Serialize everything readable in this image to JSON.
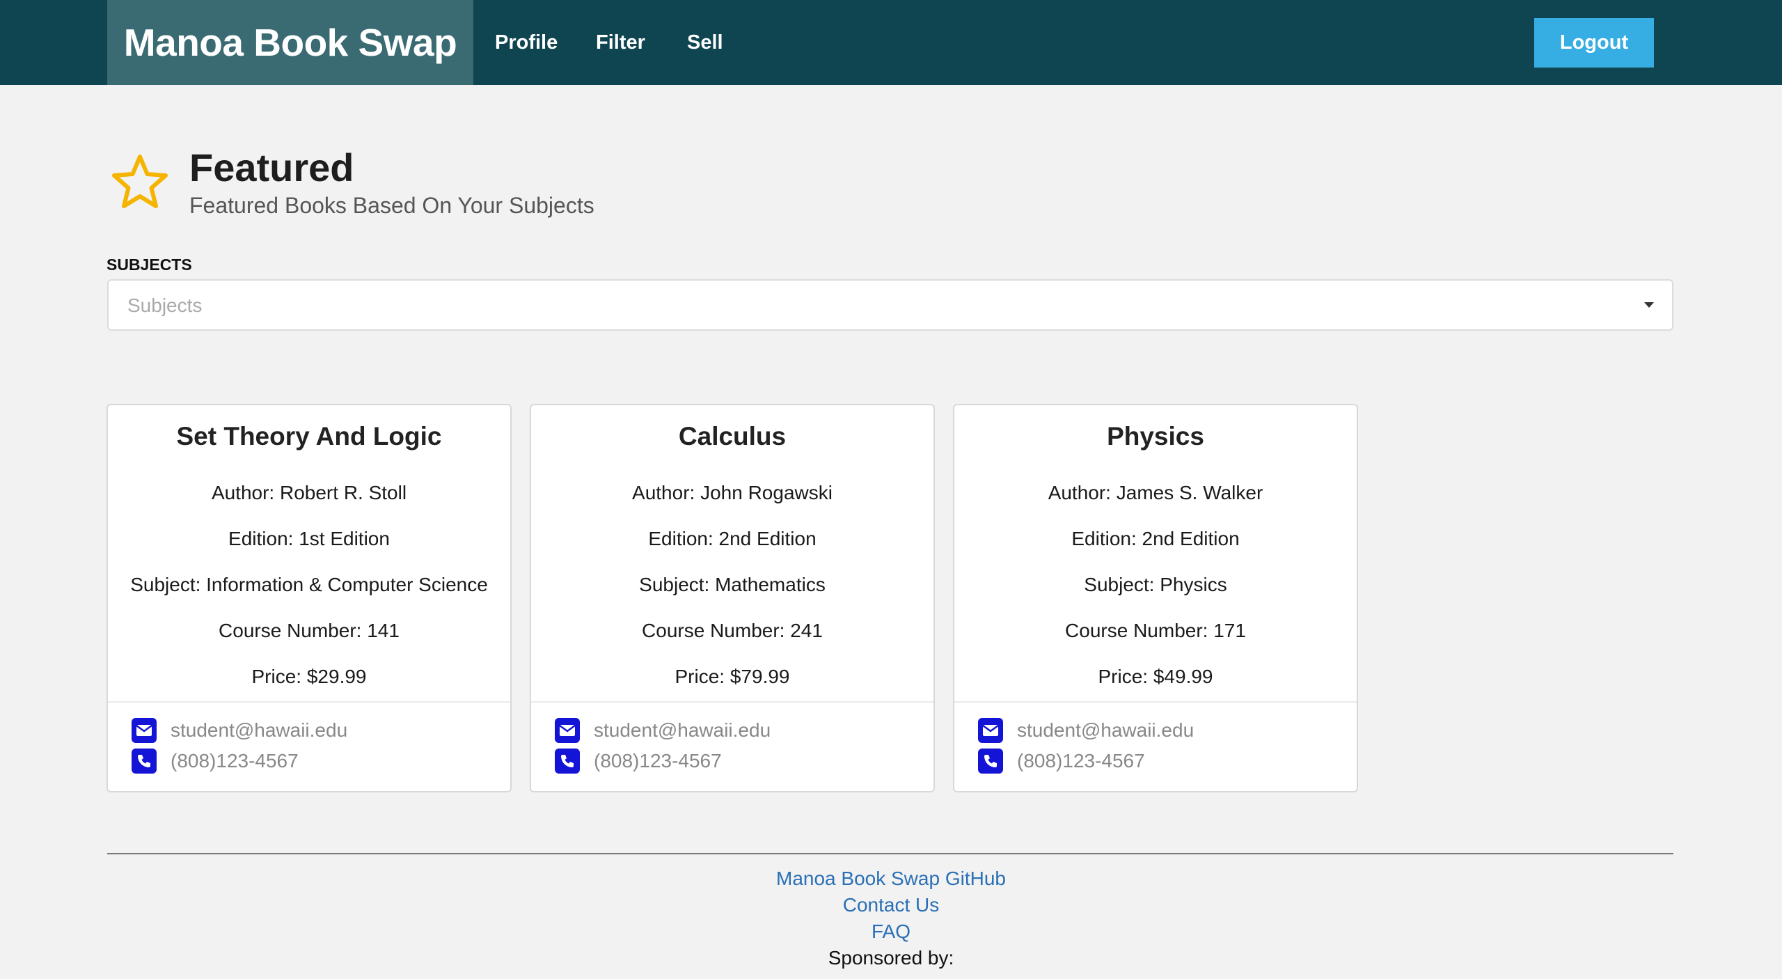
{
  "navbar": {
    "brand": "Manoa Book Swap",
    "items": [
      "Profile",
      "Filter",
      "Sell"
    ],
    "logout_label": "Logout",
    "background": "#0f4550",
    "accent": "#36ade3"
  },
  "header": {
    "icon": "star-icon",
    "title": "Featured",
    "subtitle": "Featured Books Based On Your Subjects"
  },
  "subjects": {
    "label": "SUBJECTS",
    "placeholder": "Subjects"
  },
  "cards": [
    {
      "title": "Set Theory And Logic",
      "author": "Author: Robert R. Stoll",
      "edition": "Edition: 1st Edition",
      "subject": "Subject: Information & Computer Science",
      "course": "Course Number: 141",
      "price": "Price: $29.99",
      "email": "student@hawaii.edu",
      "phone": "(808)123-4567"
    },
    {
      "title": "Calculus",
      "author": "Author: John Rogawski",
      "edition": "Edition: 2nd Edition",
      "subject": "Subject: Mathematics",
      "course": "Course Number: 241",
      "price": "Price: $79.99",
      "email": "student@hawaii.edu",
      "phone": "(808)123-4567"
    },
    {
      "title": "Physics",
      "author": "Author: James S. Walker",
      "edition": "Edition: 2nd Edition",
      "subject": "Subject: Physics",
      "course": "Course Number: 171",
      "price": "Price: $49.99",
      "email": "student@hawaii.edu",
      "phone": "(808)123-4567"
    }
  ],
  "footer": {
    "github_link": "Manoa Book Swap GitHub",
    "contact_link": "Contact Us",
    "faq_link": "FAQ",
    "sponsored": "Sponsored by:"
  }
}
